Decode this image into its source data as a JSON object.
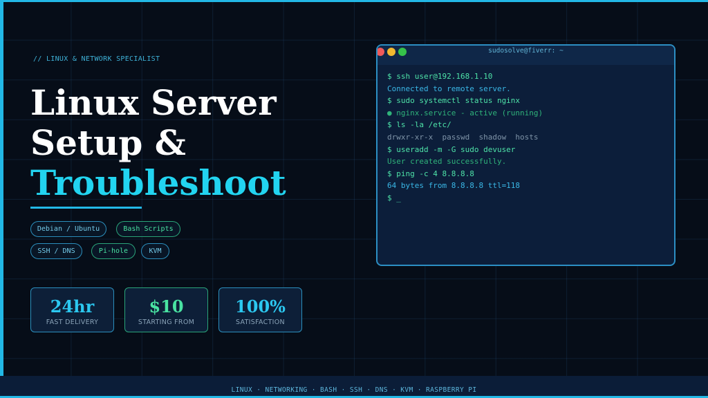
{
  "hero": {
    "tagline": "// LINUX & NETWORK SPECIALIST",
    "title_line1": "Linux Server",
    "title_line2": "Setup &",
    "title_line3": "Troubleshoot"
  },
  "chips": [
    {
      "label": "Debian / Ubuntu",
      "style": "blue"
    },
    {
      "label": "Bash Scripts",
      "style": "green"
    },
    {
      "label": "SSH / DNS",
      "style": "blue"
    },
    {
      "label": "Pi-hole",
      "style": "green"
    },
    {
      "label": "KVM",
      "style": "blue"
    }
  ],
  "stats": [
    {
      "value": "24hr",
      "caption": "FAST DELIVERY",
      "style": "blue"
    },
    {
      "value": "$10",
      "caption": "STARTING FROM",
      "style": "green"
    },
    {
      "value": "100%",
      "caption": "SATISFACTION",
      "style": "blue"
    }
  ],
  "terminal": {
    "title": "sudosolve@fiverr: ~",
    "lines": [
      {
        "text": "$ ssh user@192.168.1.10",
        "kind": "cmd"
      },
      {
        "text": "Connected to remote server.",
        "kind": "out"
      },
      {
        "text": "$ sudo systemctl status nginx",
        "kind": "cmd"
      },
      {
        "text": "● nginx.service - active (running)",
        "kind": "ok"
      },
      {
        "text": "$ ls -la /etc/",
        "kind": "cmd"
      },
      {
        "text": "drwxr-xr-x  passwd  shadow  hosts",
        "kind": "dim"
      },
      {
        "text": "$ useradd -m -G sudo devuser",
        "kind": "cmd"
      },
      {
        "text": "User created successfully.",
        "kind": "ok"
      },
      {
        "text": "$ ping -c 4 8.8.8.8",
        "kind": "cmd"
      },
      {
        "text": "64 bytes from 8.8.8.8 ttl=118",
        "kind": "out"
      },
      {
        "text": "$ _",
        "kind": "prompt"
      }
    ]
  },
  "footer": {
    "text": "LINUX · NETWORKING · BASH · SSH · DNS · KVM · RASPBERRY PI"
  },
  "colors": {
    "accent": "#22b8e6",
    "green": "#49e3a2",
    "background": "#060d18"
  }
}
